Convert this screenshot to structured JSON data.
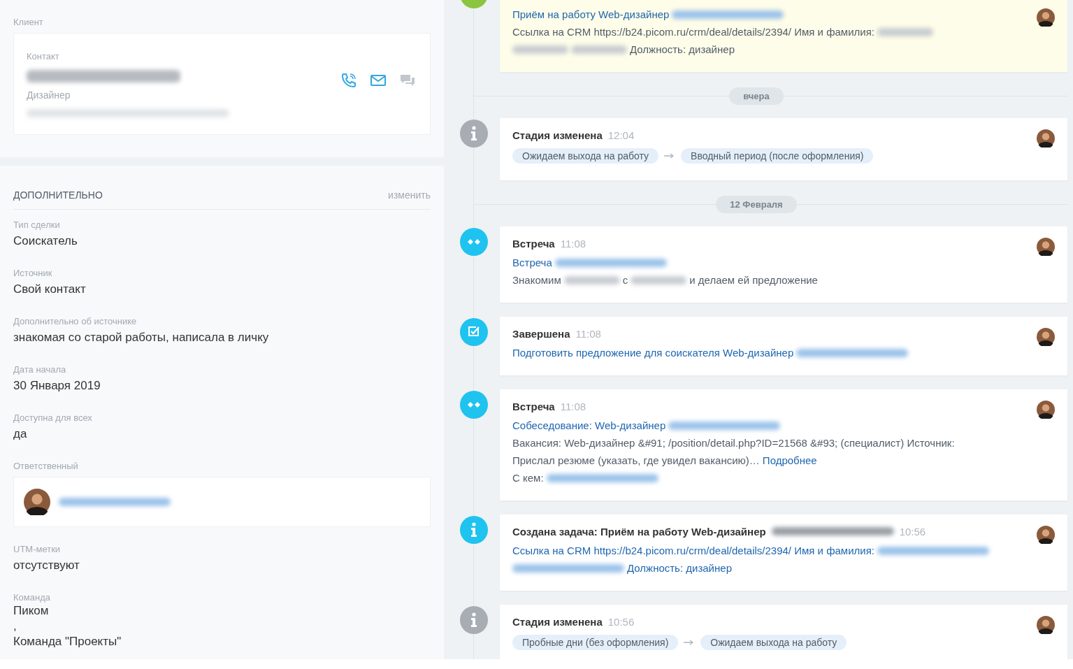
{
  "client": {
    "label": "Клиент",
    "card": {
      "label": "Контакт",
      "name": {
        "kind": "blurred-name"
      },
      "position": "Дизайнер",
      "details": {
        "kind": "blurred-details"
      },
      "actions": [
        {
          "kind": "phone",
          "disabled": false
        },
        {
          "kind": "mail",
          "disabled": false
        },
        {
          "kind": "chat",
          "disabled": true
        }
      ]
    }
  },
  "additional": {
    "title": "ДОПОЛНИТЕЛЬНО",
    "edit": "изменить",
    "fields": [
      {
        "kind": "text",
        "label": "Тип сделки",
        "value": "Соискатель"
      },
      {
        "kind": "text",
        "label": "Источник",
        "value": "Свой контакт"
      },
      {
        "kind": "text",
        "label": "Дополнительно об источнике",
        "value": "знакомая со старой работы, написала в личку"
      },
      {
        "kind": "text",
        "label": "Дата начала",
        "value": "30 Января 2019"
      },
      {
        "kind": "text",
        "label": "Доступна для всех",
        "value": "да"
      },
      {
        "kind": "user",
        "label": "Ответственный",
        "user": {
          "kind": "blurred-link"
        }
      },
      {
        "kind": "text",
        "label": "UTM-метки",
        "value": "отсутствуют"
      },
      {
        "kind": "list",
        "label": "Команда",
        "values": [
          "Пиком",
          ",",
          "Команда \"Проекты\""
        ]
      }
    ]
  },
  "timeline": [
    {
      "kind": "task",
      "highlight": true,
      "avatar": true,
      "body": [
        {
          "kind": "line",
          "segments": [
            {
              "kind": "link",
              "text": "Приём на работу Web-дизайнер"
            },
            {
              "kind": "blurred-link"
            }
          ]
        },
        {
          "kind": "line",
          "segments": [
            {
              "kind": "text",
              "text": "Ссылка на CRM https://b24.picom.ru/crm/deal/details/2394/ Имя и фамилия:"
            },
            {
              "kind": "blurred-text"
            }
          ]
        },
        {
          "kind": "line",
          "segments": [
            {
              "kind": "blurred-text"
            },
            {
              "kind": "blurred-text"
            },
            {
              "kind": "text",
              "text": "Должность: дизайнер"
            }
          ]
        }
      ]
    },
    {
      "kind": "date",
      "label": "вчера"
    },
    {
      "kind": "stage",
      "highlight": false,
      "avatar": true,
      "title": [
        {
          "kind": "title",
          "text": "Стадия изменена"
        }
      ],
      "time": "12:04",
      "body": [
        {
          "kind": "stages",
          "stages": [
            "Ожидаем выхода на работу",
            "Вводный период (после оформления)"
          ]
        }
      ]
    },
    {
      "kind": "date",
      "label": "12 Февраля"
    },
    {
      "kind": "meeting",
      "highlight": false,
      "avatar": true,
      "title": [
        {
          "kind": "title",
          "text": "Встреча"
        }
      ],
      "time": "11:08",
      "body": [
        {
          "kind": "line",
          "segments": [
            {
              "kind": "link",
              "text": "Встреча"
            },
            {
              "kind": "blurred-link"
            }
          ]
        },
        {
          "kind": "line",
          "segments": [
            {
              "kind": "text",
              "text": "Знакомим"
            },
            {
              "kind": "blurred-text"
            },
            {
              "kind": "text",
              "text": "с"
            },
            {
              "kind": "blurred-text"
            },
            {
              "kind": "text",
              "text": "и делаем ей предложение"
            }
          ]
        }
      ]
    },
    {
      "kind": "done",
      "highlight": false,
      "avatar": true,
      "title": [
        {
          "kind": "title",
          "text": "Завершена"
        }
      ],
      "time": "11:08",
      "body": [
        {
          "kind": "line",
          "segments": [
            {
              "kind": "link",
              "text": "Подготовить предложение для соискателя Web-дизайнер"
            },
            {
              "kind": "blurred-link"
            }
          ]
        }
      ]
    },
    {
      "kind": "meeting",
      "highlight": false,
      "avatar": true,
      "title": [
        {
          "kind": "title",
          "text": "Встреча"
        }
      ],
      "time": "11:08",
      "body": [
        {
          "kind": "line",
          "segments": [
            {
              "kind": "link",
              "text": "Собеседование: Web-дизайнер"
            },
            {
              "kind": "blurred-link"
            }
          ]
        },
        {
          "kind": "line",
          "segments": [
            {
              "kind": "text",
              "text": "Вакансия: Web-дизайнер &#91; /position/detail.php?ID=21568 &#93; (специалист) Источник:"
            }
          ]
        },
        {
          "kind": "line",
          "segments": [
            {
              "kind": "text",
              "text": "Прислал резюме (указать, где увидел вакансию)…"
            },
            {
              "kind": "link",
              "text": "Подробнее"
            }
          ]
        },
        {
          "kind": "line",
          "segments": [
            {
              "kind": "text",
              "text": "С кем:"
            },
            {
              "kind": "blurred-link"
            }
          ]
        }
      ]
    },
    {
      "kind": "info",
      "highlight": false,
      "avatar": true,
      "title": [
        {
          "kind": "title",
          "text": "Создана задача: Приём на работу Web-дизайнер"
        },
        {
          "kind": "blurred-title"
        }
      ],
      "time": "10:56",
      "body": [
        {
          "kind": "line",
          "segments": [
            {
              "kind": "link",
              "text": "Ссылка на CRM https://b24.picom.ru/crm/deal/details/2394/ Имя и фамилия:"
            },
            {
              "kind": "blurred-link"
            }
          ]
        },
        {
          "kind": "line",
          "segments": [
            {
              "kind": "blurred-link"
            },
            {
              "kind": "link",
              "text": "Должность: дизайнер"
            }
          ]
        }
      ]
    },
    {
      "kind": "stage",
      "highlight": false,
      "avatar": true,
      "title": [
        {
          "kind": "title",
          "text": "Стадия изменена"
        }
      ],
      "time": "10:56",
      "body": [
        {
          "kind": "stages",
          "stages": [
            "Пробные дни (без оформления)",
            "Ожидаем выхода на работу"
          ]
        }
      ]
    }
  ]
}
